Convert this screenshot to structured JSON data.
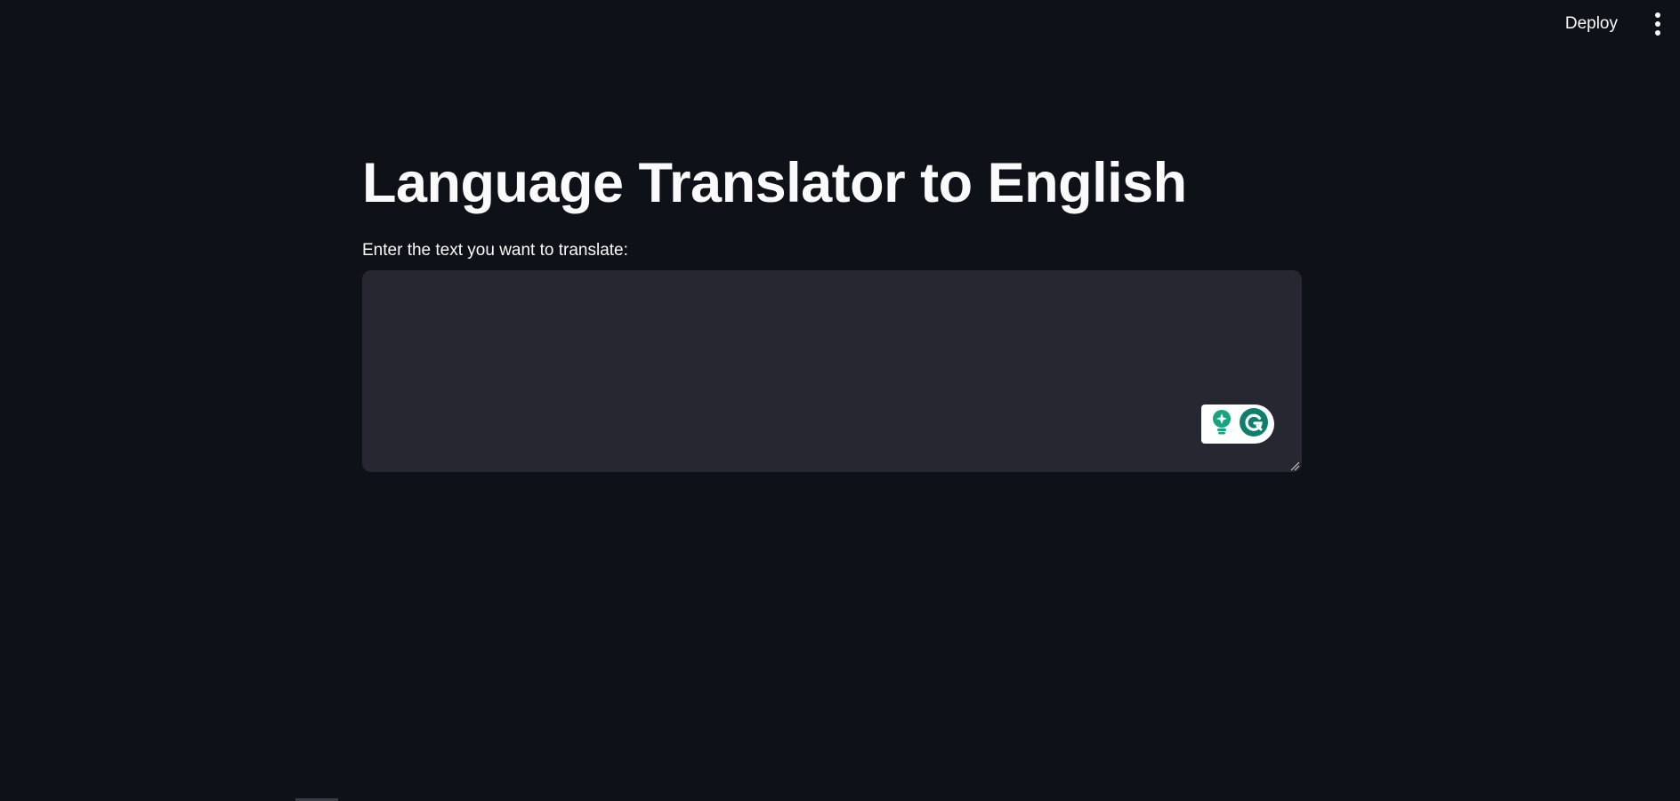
{
  "toolbar": {
    "deploy_label": "Deploy",
    "menu_icon": "vertical-ellipsis-icon"
  },
  "main": {
    "title": "Language Translator to English",
    "input_label": "Enter the text you want to translate:",
    "input_value": "",
    "input_placeholder": ""
  },
  "widgets": {
    "assist_icon": "lightbulb-sparkle-icon",
    "grammarly_icon": "grammarly-g-icon",
    "accent_color": "#15a57f"
  },
  "colors": {
    "background": "#0e1117",
    "input_background": "#262730",
    "text": "#fafafa"
  }
}
